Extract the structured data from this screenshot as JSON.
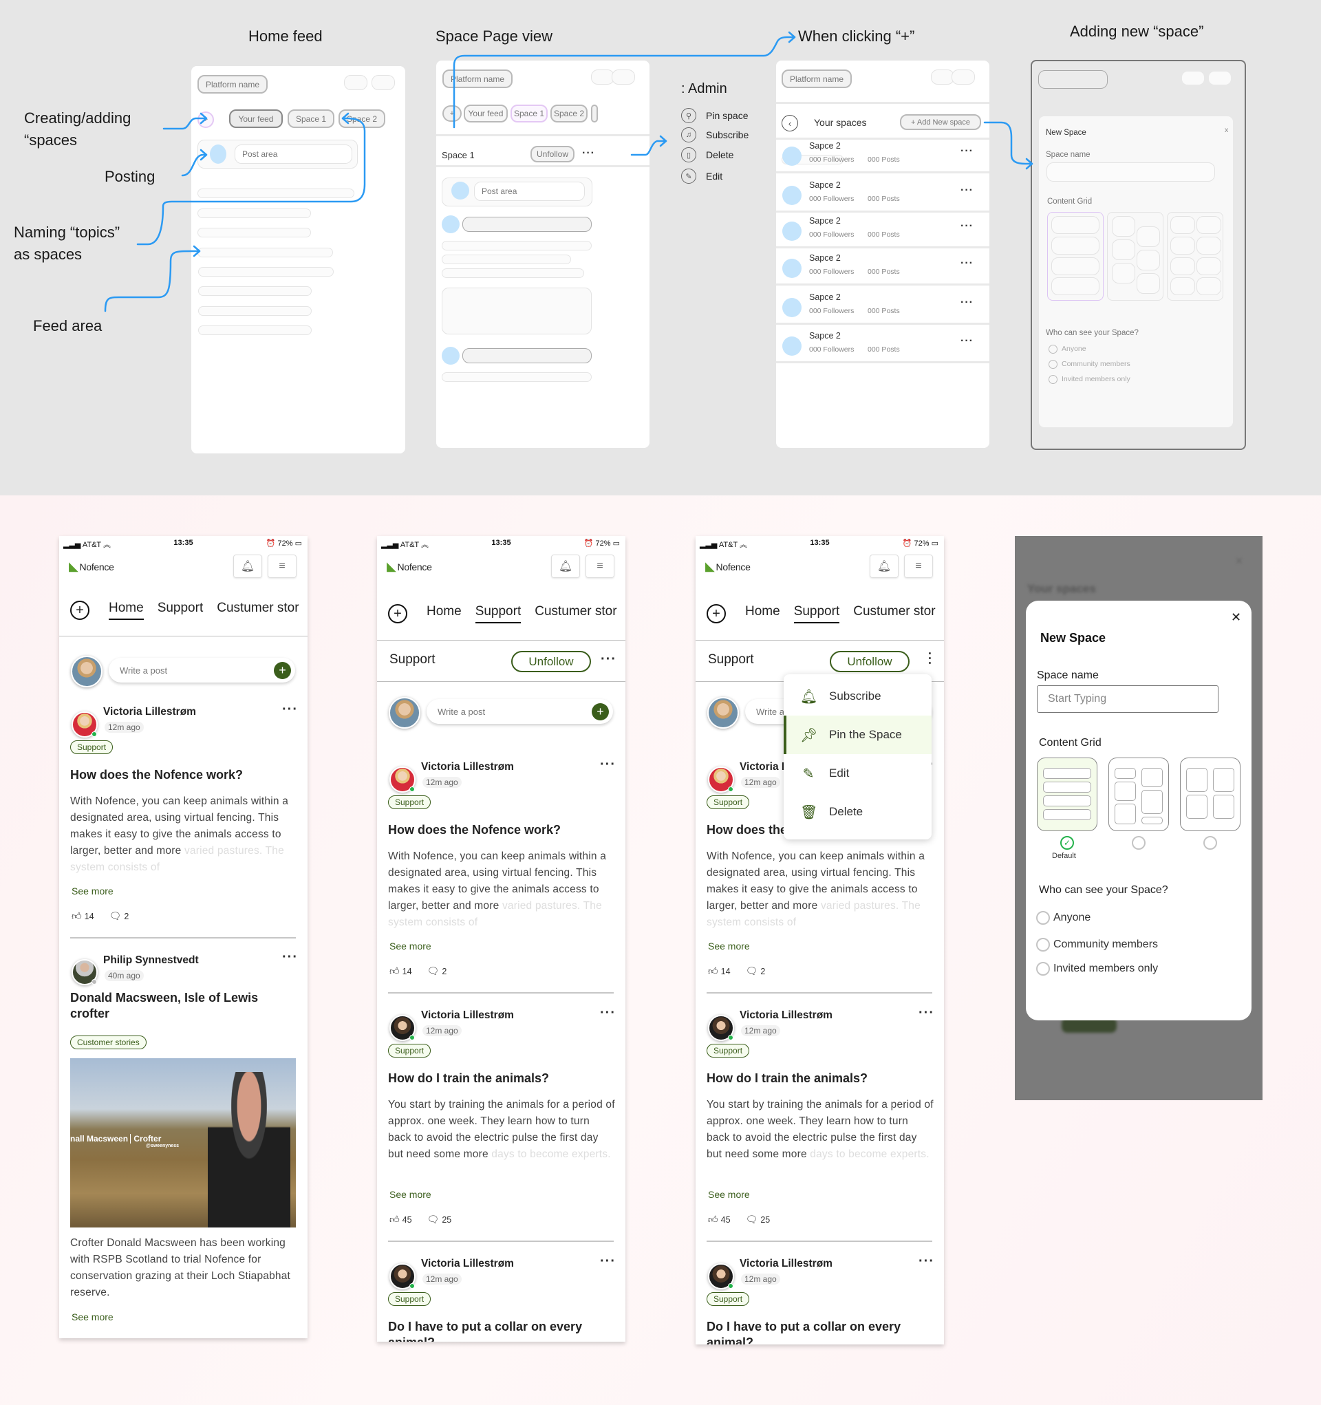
{
  "sections": {
    "home_feed": "Home feed",
    "space_page_view": "Space Page view",
    "when_clicking_plus": "When clicking “+”",
    "adding_new_space": "Adding new “space”"
  },
  "annotations": {
    "creating": [
      "Creating/adding",
      "“spaces"
    ],
    "posting": "Posting",
    "naming": [
      "Naming “topics”",
      "as spaces"
    ],
    "feed_area": "Feed area"
  },
  "wireframes": {
    "platform_name": "Platform name",
    "plus": "+",
    "tabs": [
      "Your feed",
      "Space 1",
      "Space 2"
    ],
    "post_area": "Post area",
    "space_title": "Space 1",
    "unfollow": "Unfollow",
    "admin": {
      "title": ": Admin",
      "items": [
        {
          "label": "Pin space",
          "icon": "pin-icon"
        },
        {
          "label": "Subscribe",
          "icon": "bell-icon"
        },
        {
          "label": "Delete",
          "icon": "trash-icon"
        },
        {
          "label": "Edit",
          "icon": "edit-icon"
        }
      ]
    },
    "your_spaces": {
      "title": "Your spaces",
      "add_button": "+ Add New space",
      "items": [
        {
          "name": "Sapce 2",
          "followers": "000 Followers",
          "posts": "000 Posts"
        },
        {
          "name": "Sapce 2",
          "followers": "000 Followers",
          "posts": "000 Posts"
        },
        {
          "name": "Sapce 2",
          "followers": "000 Followers",
          "posts": "000 Posts"
        },
        {
          "name": "Sapce 2",
          "followers": "000 Followers",
          "posts": "000 Posts"
        },
        {
          "name": "Sapce 2",
          "followers": "000 Followers",
          "posts": "000 Posts"
        },
        {
          "name": "Sapce 2",
          "followers": "000 Followers",
          "posts": "000 Posts"
        }
      ]
    },
    "new_space": {
      "title": "New Space",
      "close": "x",
      "space_name_label": "Space name",
      "content_grid_label": "Content Grid",
      "visibility_label": "Who can see your Space?",
      "options": [
        "Anyone",
        "Community members",
        "Invited members only"
      ]
    }
  },
  "phone": {
    "status": {
      "carrier": "AT&T",
      "time": "13:35",
      "battery": "72%"
    },
    "brand": "Nofence",
    "tabs": [
      "Home",
      "Support",
      "Custumer stor"
    ],
    "write_placeholder": "Write a post",
    "space_header": "Support",
    "unfollow": "Unfollow",
    "see_more": "See more",
    "posts": {
      "nofence_work": {
        "author": "Victoria Lillestrøm",
        "time": "12m ago",
        "tag": "Support",
        "title": "How does the Nofence work?",
        "body": "With Nofence, you can keep animals within a designated area, using virtual fencing. This makes it easy to give the animals access to larger, better and more",
        "body_fade": "varied pastures. The system consists of",
        "likes": "14",
        "comments": "2"
      },
      "crofter": {
        "author": "Philip Synnestvedt",
        "time": "40m ago",
        "tag": "Customer stories",
        "title": "Donald Macsween, Isle of Lewis crofter",
        "photo_caption_name": "nall Macsween",
        "photo_caption_role": "Crofter",
        "photo_caption_handle": "@sweenyness",
        "body": "Crofter Donald Macsween has been working with RSPB Scotland to trial Nofence for conservation grazing at their Loch Stiapabhat reserve."
      },
      "train": {
        "author": "Victoria Lillestrøm",
        "time": "12m ago",
        "tag": "Support",
        "title": "How do I train the animals?",
        "body": "You start by training the animals for a period of approx. one week. They learn how to turn back to avoid the electric pulse the first day but need some more",
        "body_fade": "days to become experts.",
        "likes": "45",
        "comments": "25"
      },
      "collar": {
        "author": "Victoria Lillestrøm",
        "time": "12m ago",
        "tag": "Support",
        "title": "Do I have to put a collar on every animal?"
      }
    },
    "space_menu": [
      "Subscribe",
      "Pin the Space",
      "Edit",
      "Delete"
    ],
    "modal": {
      "bg_title": "Your spaces",
      "title": "New Space",
      "space_name_label": "Space name",
      "placeholder": "Start Typing",
      "content_grid_label": "Content Grid",
      "default_label": "Default",
      "visibility_label": "Who can see your Space?",
      "options": [
        "Anyone",
        "Community members",
        "Invited members only"
      ]
    }
  },
  "colors": {
    "brand_green": "#3b5e1c",
    "annotation_blue": "#2b9af3",
    "wire_avatar": "#c4e4fc",
    "online": "#24b24b"
  }
}
